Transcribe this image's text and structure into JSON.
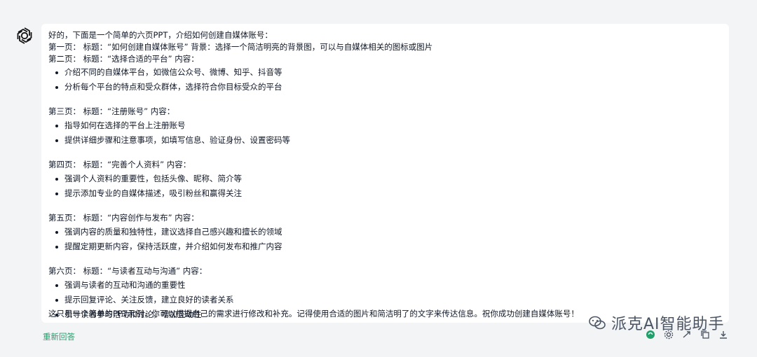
{
  "assistant": {
    "avatar_icon": "openai-logo-icon",
    "intro": "好的，下面是一个简单的六页PPT，介绍如何创建自媒体账号：",
    "page1": "第一页：  标题：“如何创建自媒体账号”  背景：选择一个简洁明亮的背景图，可以与自媒体相关的图标或图片",
    "sections": [
      {
        "head": "第二页：  标题：“选择合适的平台”  内容：",
        "bullets": [
          "介绍不同的自媒体平台，如微信公众号、微博、知乎、抖音等",
          "分析每个平台的特点和受众群体，选择符合你目标受众的平台"
        ]
      },
      {
        "head": "第三页：  标题：“注册账号”  内容：",
        "bullets": [
          "指导如何在选择的平台上注册账号",
          "提供详细步骤和注意事项，如填写信息、验证身份、设置密码等"
        ]
      },
      {
        "head": "第四页：  标题：“完善个人资料”  内容：",
        "bullets": [
          "强调个人资料的重要性，包括头像、昵称、简介等",
          "提示添加专业的自媒体描述，吸引粉丝和赢得关注"
        ]
      },
      {
        "head": "第五页：  标题：“内容创作与发布”  内容：",
        "bullets": [
          "强调内容的质量和独特性，建议选择自己感兴趣和擅长的领域",
          "提醒定期更新内容，保持活跃度，并介绍如何发布和推广内容"
        ]
      },
      {
        "head": "第六页：  标题：“与读者互动与沟通”  内容：",
        "bullets": [
          "强调与读者的互动和沟通的重要性",
          "提示回复评论、关注反馈，建立良好的读者关系",
          "引导读者参与活动和讨论，增加互动性"
        ]
      }
    ],
    "closing": "这只是一个简单的PPT示例，你可以根据自己的需求进行修改和补充。记得使用合适的图片和简洁明了的文字来传达信息。祝你成功创建自媒体账号！"
  },
  "actions": {
    "regenerate_label": "重新回答",
    "accent_color": "#22a06b"
  },
  "watermark": {
    "text": "派克AI智能助手"
  },
  "toolbar": {
    "icons": [
      "green-circle-icon",
      "gear-icon",
      "share-icon",
      "copy-icon",
      "download-icon"
    ]
  }
}
